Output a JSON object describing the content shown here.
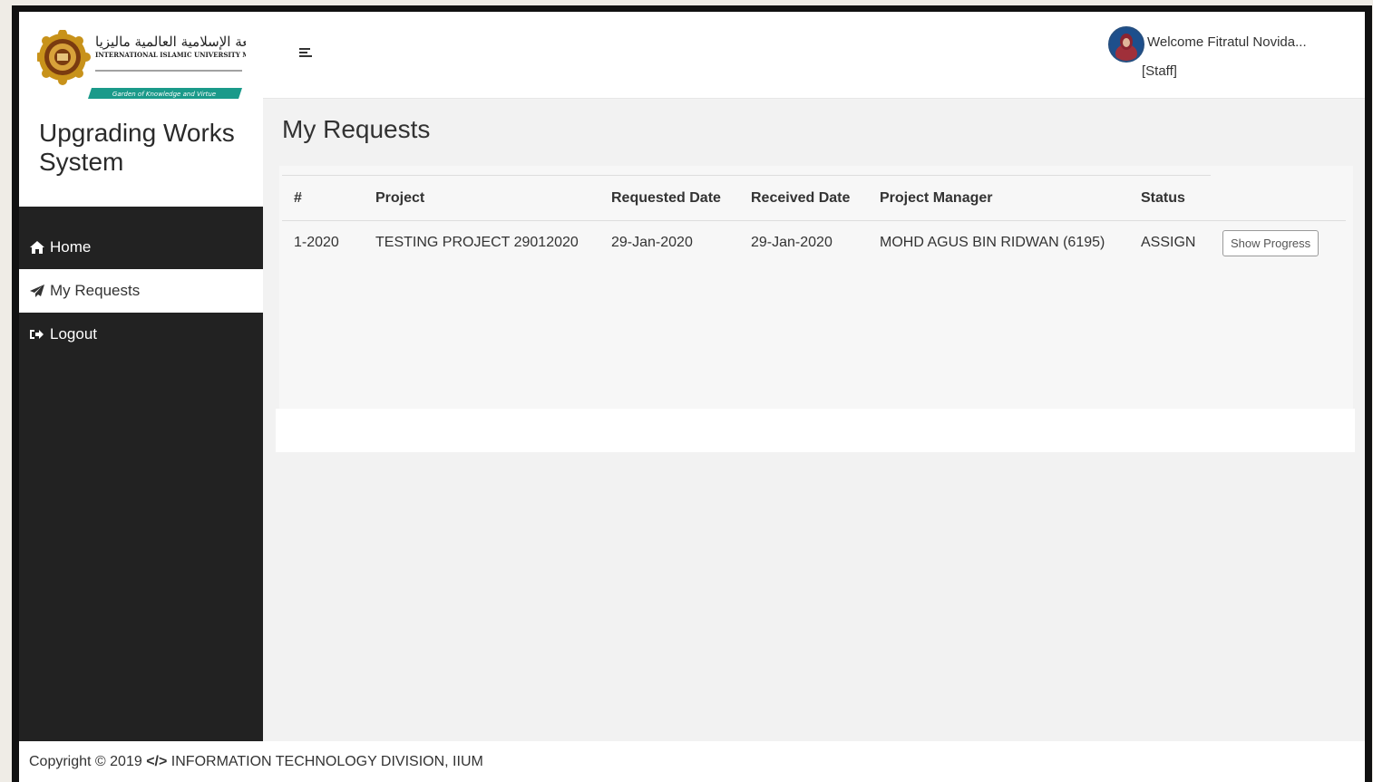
{
  "brand": {
    "logo_arabic": "الجامعة الإسلامية العالمية ماليزيا",
    "logo_english": "INTERNATIONAL ISLAMIC UNIVERSITY MALAYSIA",
    "logo_tagline": "Garden of Knowledge and Virtue",
    "system_title": "Upgrading Works System"
  },
  "nav": {
    "items": [
      {
        "label": "Home",
        "icon": "home-icon"
      },
      {
        "label": "My Requests",
        "icon": "paper-plane-icon"
      },
      {
        "label": "Logout",
        "icon": "sign-out-icon"
      }
    ],
    "active": "My Requests"
  },
  "header": {
    "welcome": "Welcome Fitratul Novida...",
    "role": "[Staff]"
  },
  "page": {
    "title": "My Requests"
  },
  "table": {
    "columns": [
      "#",
      "Project",
      "Requested Date",
      "Received Date",
      "Project Manager",
      "Status"
    ],
    "rows": [
      {
        "id": "1-2020",
        "project": "TESTING PROJECT 29012020",
        "requested_date": "29-Jan-2020",
        "received_date": "29-Jan-2020",
        "project_manager": "MOHD AGUS BIN RIDWAN (6195)",
        "status": "ASSIGN",
        "action": "Show Progress"
      }
    ]
  },
  "footer": {
    "prefix": "Copyright © 2019",
    "code_glyph": "</>",
    "suffix": "INFORMATION TECHNOLOGY DIVISION, IIUM"
  },
  "colors": {
    "sidebar_bg": "#222222",
    "logo_green": "#1a9a8a",
    "logo_gold": "#b8860b"
  }
}
